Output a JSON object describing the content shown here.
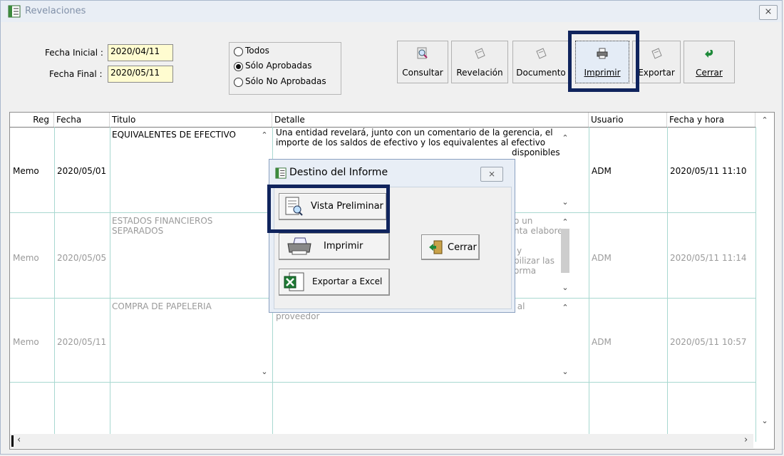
{
  "window": {
    "title": "Revelaciones",
    "close": "⨯"
  },
  "filters": {
    "fecha_inicial_label": "Fecha Inicial :",
    "fecha_inicial_value": "2020/04/11",
    "fecha_final_label": "Fecha Final :",
    "fecha_final_value": "2020/05/11",
    "radios": [
      "Todos",
      "Sólo Aprobadas",
      "Sólo No Aprobadas"
    ],
    "selected_radio": "Sólo Aprobadas"
  },
  "toolbar": {
    "consultar": "Consultar",
    "revelacion": "Revelación",
    "documento": "Documento",
    "imprimir": "Imprimir",
    "exportar": "Exportar",
    "cerrar": "Cerrar"
  },
  "grid": {
    "headers": [
      "Reg",
      "Fecha",
      "Titulo",
      "Detalle",
      "Usuario",
      "Fecha y hora"
    ],
    "rows": [
      {
        "reg": "Memo",
        "fecha": "2020/05/01",
        "titulo": "EQUIVALENTES DE EFECTIVO",
        "detalle_1": "Una entidad revelará, junto con un comentario de la gerencia, el",
        "detalle_2": "importe de los saldos de efectivo y los equivalentes al efectivo",
        "detalle_3": "disponibles",
        "usuario": "ADM",
        "fecha_hora": "2020/05/11 11:10"
      },
      {
        "reg": "Memo",
        "fecha": "2020/05/05",
        "titulo_1": "ESTADOS FINANCIEROS",
        "titulo_2": "SEPARADOS",
        "detalle_1": "o un",
        "detalle_2": "nta elabore",
        "detalle_3": "y",
        "detalle_4": "bilizar las",
        "detalle_5": "orma",
        "usuario": "ADM",
        "fecha_hora": "2020/05/11 11:14"
      },
      {
        "reg": "Memo",
        "fecha": "2020/05/11",
        "titulo": "COMPRA DE PAPELERIA",
        "detalle_1": "r al",
        "detalle_2": "proveedor",
        "usuario": "ADM",
        "fecha_hora": "2020/05/11 10:57"
      }
    ]
  },
  "dialog": {
    "title": "Destino del Informe",
    "close": "⨯",
    "vista": "Vista Preliminar",
    "imprimir": "Imprimir",
    "exportar_excel": "Exportar a Excel",
    "cerrar": "Cerrar"
  },
  "colors": {
    "highlight": "#10245d",
    "date_bg": "#fffcd0",
    "grid_line": "#a8d8d0"
  }
}
